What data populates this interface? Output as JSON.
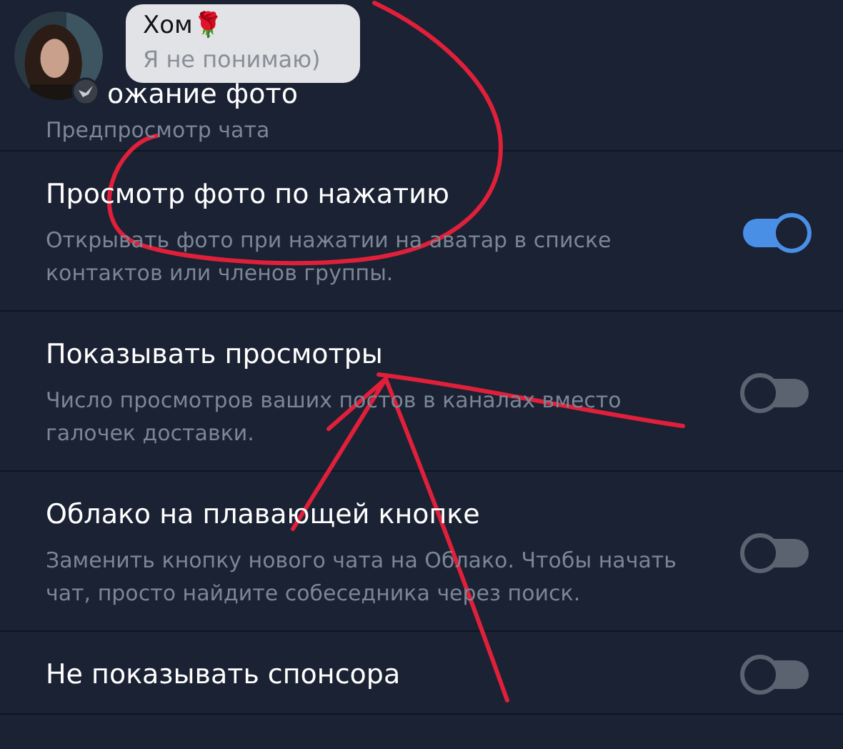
{
  "settings": [
    {
      "title": "ожание фото",
      "description": "Предпросмотр чата"
    },
    {
      "title": "Просмотр фото по нажатию",
      "description": "Открывать фото при нажатии на аватар в списке контактов или членов группы.",
      "on": true
    },
    {
      "title": "Показывать просмотры",
      "description": "Число просмотров ваших постов в каналах вместо галочек доставки.",
      "on": false
    },
    {
      "title": "Облако на плавающей кнопке",
      "description": "Заменить кнопку нового чата на Облако. Чтобы начать чат, просто найдите собеседника через поиск.",
      "on": false
    },
    {
      "title": "Не показывать спонсора",
      "on": false
    }
  ],
  "popup": {
    "name": "Хом🌹",
    "message": "Я не понимаю)"
  }
}
